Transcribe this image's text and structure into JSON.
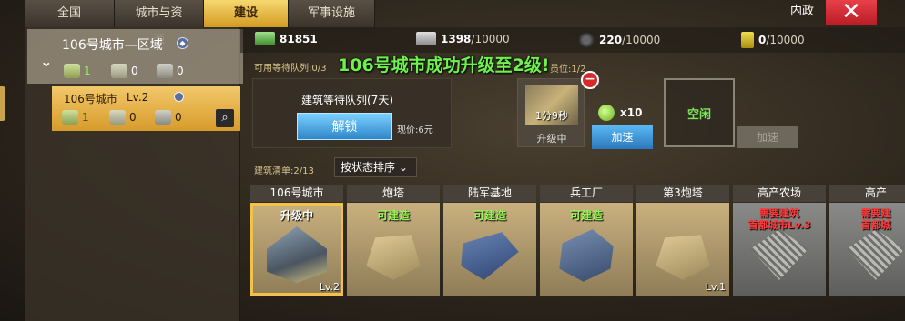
{
  "tabs": [
    {
      "label": "全国"
    },
    {
      "label": "城市与资源"
    },
    {
      "label": "建设",
      "active": true
    },
    {
      "label": "军事设施"
    }
  ],
  "header": {
    "gov_label": "内政",
    "close_icon": "close-icon"
  },
  "sidebar": {
    "region": {
      "title": "106号城市—区域",
      "stats": {
        "build": "1",
        "money": "0",
        "repair": "0"
      }
    },
    "city": {
      "name": "106号城市",
      "level": "Lv.2",
      "stats": {
        "build": "1",
        "money": "0",
        "repair": "0"
      }
    }
  },
  "resources": [
    {
      "name": "cash",
      "value": "81851",
      "max": ""
    },
    {
      "name": "steel",
      "value": "1398",
      "max": "/10000"
    },
    {
      "name": "rubber",
      "value": "220",
      "max": "/10000"
    },
    {
      "name": "oil",
      "value": "0",
      "max": "/10000"
    }
  ],
  "queue": {
    "available_label": "可用等待队列:0/3",
    "success_message": "106号城市成功升级至2级!",
    "slot_label": "员位:1/2",
    "queue_title": "建筑等待队列(7天)",
    "unlock_label": "解锁",
    "price": "现价:6元",
    "upgrade_timer": "1分9秒",
    "upgrade_state": "升级中",
    "speed_item_count": "x10",
    "speed_label": "加速",
    "idle_label": "空闲",
    "speed_label_disabled": "加速"
  },
  "list": {
    "count_label": "建筑清单:2/13",
    "sort_label": "按状态排序"
  },
  "buildings": [
    {
      "name": "106号城市",
      "status": "升级中",
      "level": "Lv.2"
    },
    {
      "name": "炮塔",
      "status": "可建造",
      "level": ""
    },
    {
      "name": "陆军基地",
      "status": "可建造",
      "level": ""
    },
    {
      "name": "兵工厂",
      "status": "可建造",
      "level": ""
    },
    {
      "name": "第3炮塔",
      "status": "",
      "level": "Lv.1"
    },
    {
      "name": "高产农场",
      "status": "需要建筑\n首都城市Lv.3",
      "level": ""
    },
    {
      "name": "高产",
      "status": "需要建\n首都城",
      "level": ""
    }
  ],
  "colors": {
    "accent": "#d49a22",
    "success": "#6cf24a",
    "danger": "#d62a2a",
    "button_blue": "#2f86c8"
  }
}
